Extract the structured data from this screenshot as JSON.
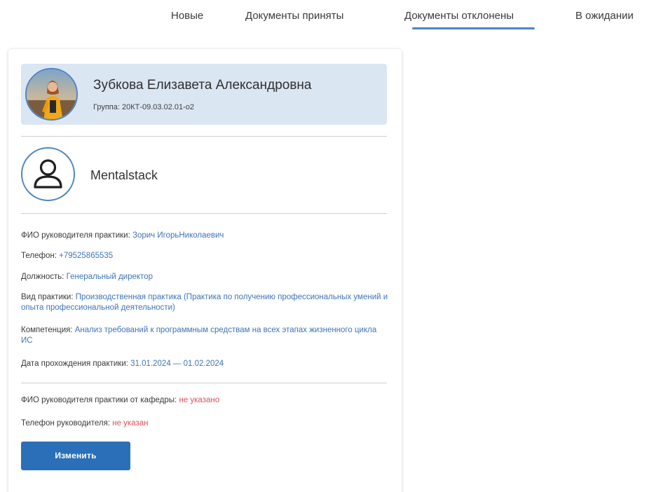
{
  "tabs": [
    {
      "label": "Новые",
      "active": false
    },
    {
      "label": "Документы приняты",
      "active": false
    },
    {
      "label": "Документы отклонены",
      "active": true
    },
    {
      "label": "В ожидании",
      "active": false
    }
  ],
  "colors": {
    "accent": "#4d84c4",
    "button": "#2a6fb8",
    "value_link": "#3f74b8",
    "missing": "#e0505a",
    "student_bg": "#dbe6f3"
  },
  "student": {
    "avatar_icon": "student-photo",
    "name": "Зубкова Елизавета Александровна",
    "group_label": "Группа:",
    "group_value": "20КТ-09.03.02.01-о2"
  },
  "company": {
    "avatar_icon": "user-icon",
    "name": "Mentalstack"
  },
  "details": [
    {
      "label": "ФИО руководителя практики:",
      "value": "Зорич ИгорьНиколаевич"
    },
    {
      "label": "Телефон:",
      "value": "+79525865535"
    },
    {
      "label": "Должность:",
      "value": "Генеральный директор"
    },
    {
      "label": "Вид практики:",
      "value": "Производственная практика (Практика по получению профессиональных умений и опыта профессиональной деятельности)"
    },
    {
      "label": "Компетенция:",
      "value": "Анализ требований к программным средствам на всех этапах жизненного цикла ИС"
    },
    {
      "label": "Дата прохождения практики:",
      "value": "31.01.2024 — 01.02.2024"
    }
  ],
  "department": {
    "supervisor_label": "ФИО руководителя практики от кафедры:",
    "supervisor_value": "не указано",
    "phone_label": "Телефон руководителя:",
    "phone_value": "не указан"
  },
  "actions": {
    "edit_label": "Изменить"
  }
}
